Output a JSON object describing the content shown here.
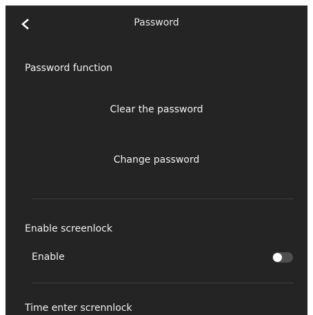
{
  "header": {
    "title": "Password",
    "back_icon": "chevron-left-icon"
  },
  "password_function": {
    "section_title": "Password function",
    "clear_label": "Clear the password",
    "change_label": "Change password"
  },
  "screenlock": {
    "section_title": "Enable screenlock",
    "enable_label": "Enable",
    "enabled": false
  },
  "time_screenlock": {
    "section_title": "Time enter scrennlock"
  },
  "colors": {
    "background": "#242424",
    "text": "#f2f2f2",
    "divider": "#3d3d3d",
    "toggle_off_track": "#4f4f4f",
    "toggle_knob": "#ffffff"
  }
}
